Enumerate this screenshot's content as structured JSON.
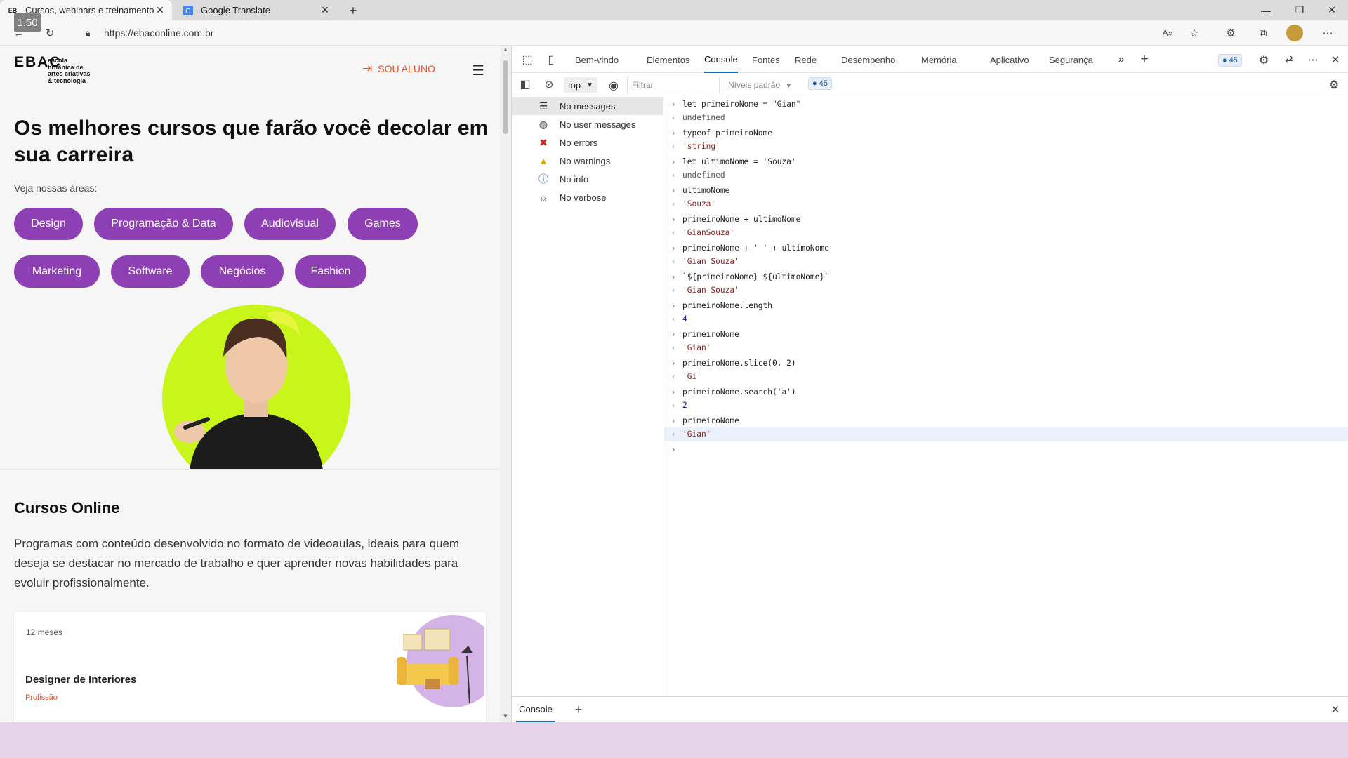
{
  "browser": {
    "tabs": [
      {
        "title": "Cursos, webinars e treinamento",
        "active": true
      },
      {
        "title": "Google Translate",
        "active": false
      }
    ],
    "playback_speed": "1.50",
    "url": "https://ebaconline.com.br"
  },
  "site": {
    "logo_mark": "EBAC",
    "logo_words": [
      "escola",
      "britânica de",
      "artes criativas",
      "& tecnologia"
    ],
    "login_label": "SOU ALUNO",
    "headline": "Os melhores cursos que farão você decolar em sua carreira",
    "areas_label": "Veja nossas áreas:",
    "area_pills_row1": [
      "Design",
      "Programação & Data",
      "Audiovisual",
      "Games"
    ],
    "area_pills_row2": [
      "Marketing",
      "Software",
      "Negócios",
      "Fashion"
    ],
    "courses_title": "Cursos Online",
    "courses_desc": "Programas com conteúdo desenvolvido no formato de videoaulas, ideais para quem deseja se destacar no mercado de trabalho e quer aprender novas habilidades para evoluir profissionalmente.",
    "card": {
      "duration": "12 meses",
      "name": "Designer de Interiores",
      "type": "Profissão"
    },
    "colors": {
      "accent": "#e2542b",
      "pill": "#8d3fb3",
      "hero_circle": "#c8f51a"
    }
  },
  "devtools": {
    "tabs": [
      "Bem-vindo",
      "Elementos",
      "Console",
      "Fontes",
      "Rede",
      "Desempenho",
      "Memória",
      "Aplicativo",
      "Segurança"
    ],
    "active_tab": "Console",
    "issues_count": "45",
    "context": "top",
    "filter_placeholder": "Filtrar",
    "levels": "Níveis padrão",
    "sidebar": [
      {
        "label": "No messages",
        "icon": "list-icon"
      },
      {
        "label": "No user messages",
        "icon": "user-icon"
      },
      {
        "label": "No errors",
        "icon": "error-icon"
      },
      {
        "label": "No warnings",
        "icon": "warning-icon"
      },
      {
        "label": "No info",
        "icon": "info-icon"
      },
      {
        "label": "No verbose",
        "icon": "bug-icon"
      }
    ],
    "console_lines": [
      {
        "dir": "in",
        "text": "let primeiroNome = \"Gian\""
      },
      {
        "dir": "out",
        "text": "undefined",
        "kind": "und"
      },
      {
        "dir": "in",
        "text": "typeof primeiroNome"
      },
      {
        "dir": "out",
        "text": "'string'",
        "kind": "str"
      },
      {
        "dir": "in",
        "text": "let ultimoNome = 'Souza'"
      },
      {
        "dir": "out",
        "text": "undefined",
        "kind": "und"
      },
      {
        "dir": "in",
        "text": "ultimoNome"
      },
      {
        "dir": "out",
        "text": "'Souza'",
        "kind": "str"
      },
      {
        "dir": "in",
        "text": "primeiroNome + ultimoNome"
      },
      {
        "dir": "out",
        "text": "'GianSouza'",
        "kind": "str"
      },
      {
        "dir": "in",
        "text": "primeiroNome + ' ' + ultimoNome"
      },
      {
        "dir": "out",
        "text": "'Gian Souza'",
        "kind": "str"
      },
      {
        "dir": "in",
        "text": "`${primeiroNome} ${ultimoNome}`"
      },
      {
        "dir": "out",
        "text": "'Gian Souza'",
        "kind": "str"
      },
      {
        "dir": "in",
        "text": "primeiroNome.length"
      },
      {
        "dir": "out",
        "text": "4",
        "kind": "num"
      },
      {
        "dir": "in",
        "text": "primeiroNome"
      },
      {
        "dir": "out",
        "text": "'Gian'",
        "kind": "str"
      },
      {
        "dir": "in",
        "text": "primeiroNome.slice(0, 2)"
      },
      {
        "dir": "out",
        "text": "'Gi'",
        "kind": "str"
      },
      {
        "dir": "in",
        "text": "primeiroNome.search('a')"
      },
      {
        "dir": "out",
        "text": "2",
        "kind": "num"
      },
      {
        "dir": "in",
        "text": "primeiroNome"
      },
      {
        "dir": "out",
        "text": "'Gian'",
        "kind": "str",
        "highlight": true
      }
    ],
    "drawer_tab": "Console"
  }
}
